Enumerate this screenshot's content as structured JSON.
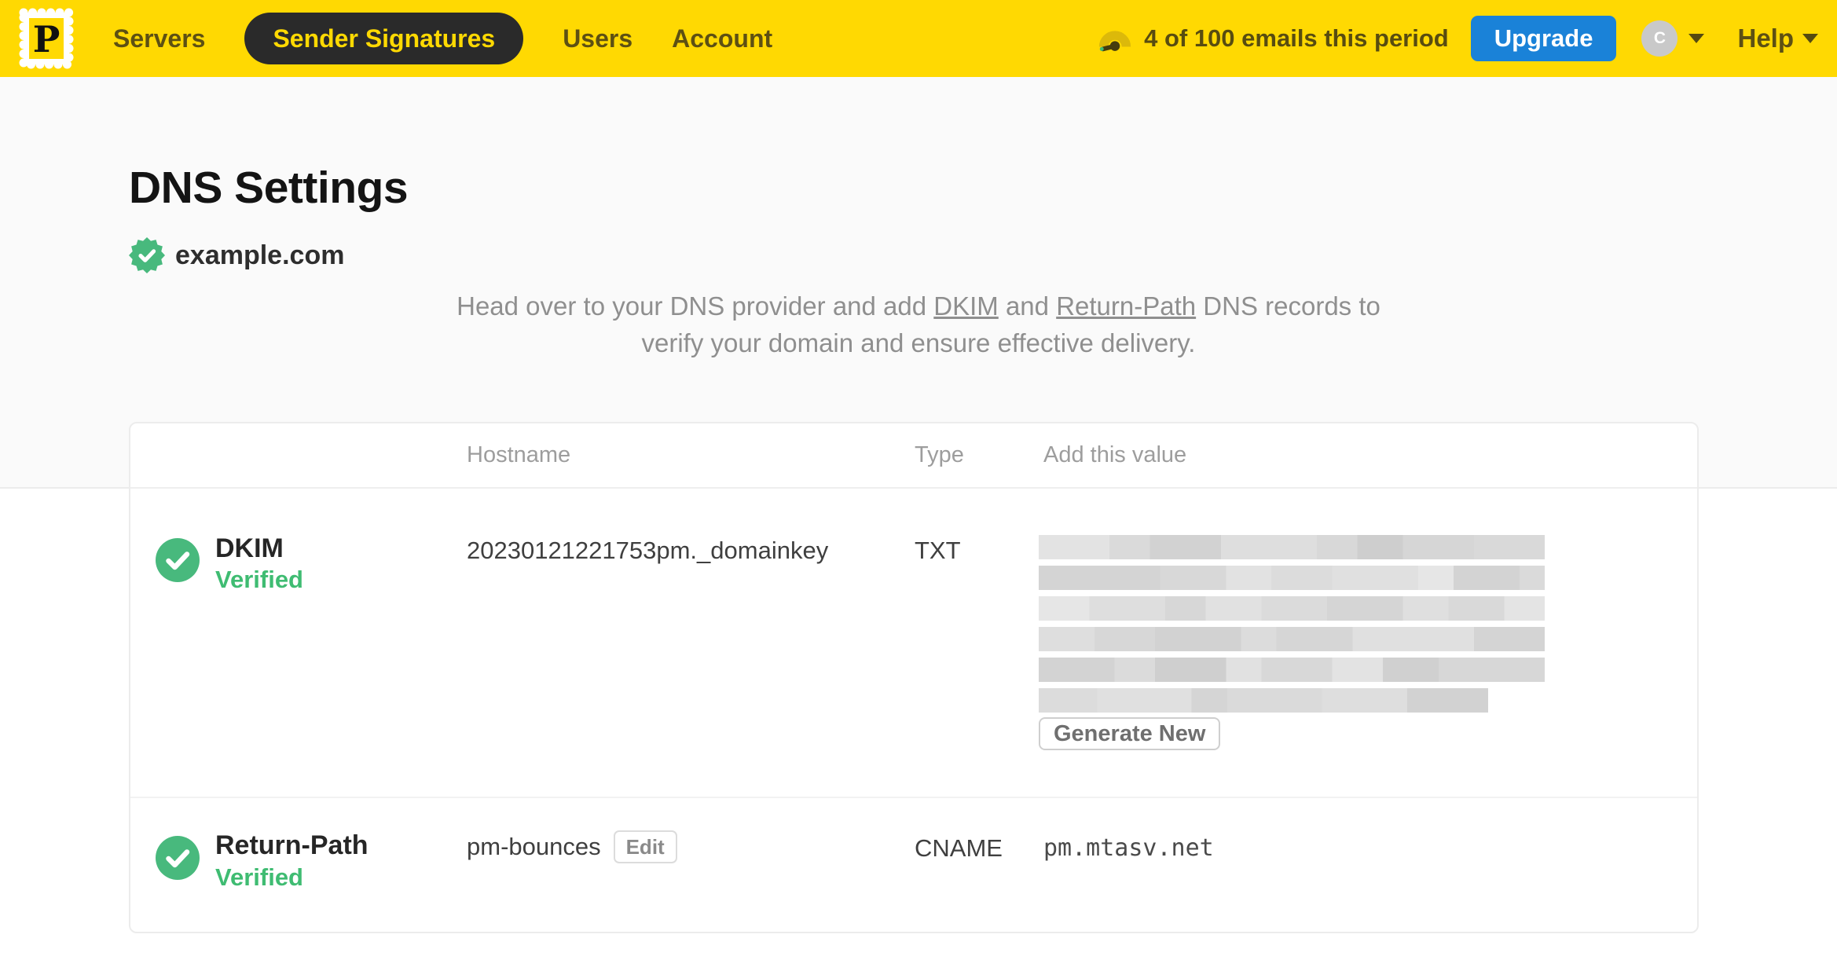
{
  "nav": {
    "logo_letter": "P",
    "items": [
      {
        "label": "Servers",
        "active": false
      },
      {
        "label": "Sender Signatures",
        "active": true
      },
      {
        "label": "Users",
        "active": false
      },
      {
        "label": "Account",
        "active": false
      }
    ],
    "usage_text": "4 of 100 emails this period",
    "upgrade_label": "Upgrade",
    "avatar_initial": "C",
    "help_label": "Help"
  },
  "page": {
    "title": "DNS Settings",
    "domain": "example.com",
    "intro_part1": "Head over to your DNS provider and add ",
    "intro_link1": "DKIM",
    "intro_part2": " and ",
    "intro_link2": "Return-Path",
    "intro_part3": " DNS records to verify your domain and ensure effective delivery."
  },
  "table": {
    "headers": {
      "hostname": "Hostname",
      "type": "Type",
      "value": "Add this value"
    },
    "rows": [
      {
        "name": "DKIM",
        "status": "Verified",
        "hostname": "20230121221753pm._domainkey",
        "type": "TXT",
        "value_redacted": true,
        "action_label": "Generate New"
      },
      {
        "name": "Return-Path",
        "status": "Verified",
        "hostname": "pm-bounces",
        "edit_label": "Edit",
        "type": "CNAME",
        "value": "pm.mtasv.net"
      }
    ]
  },
  "colors": {
    "brand_yellow": "#FFD902",
    "accent_blue": "#1A82D8",
    "success_green": "#48B97D"
  }
}
